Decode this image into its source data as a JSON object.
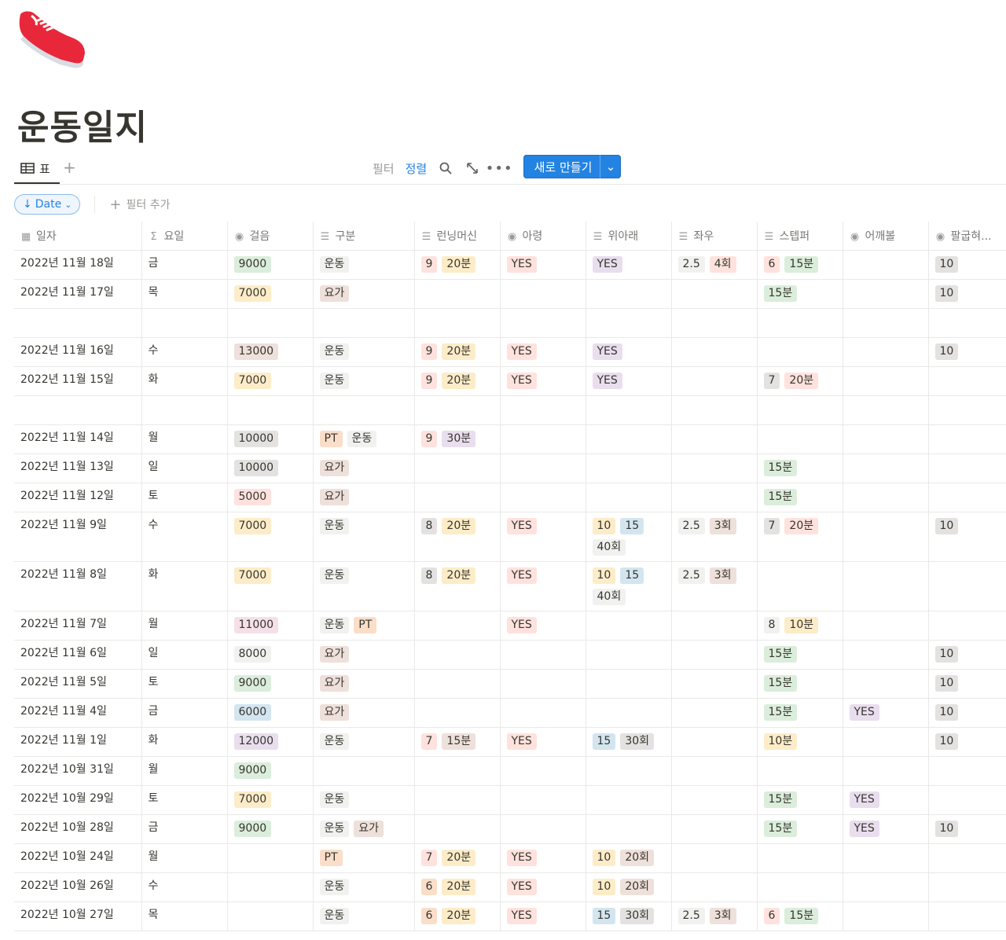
{
  "page": {
    "icon": "sneaker-icon",
    "title": "운동일지"
  },
  "views": {
    "tab_label": "표",
    "add_view_icon": "plus-icon"
  },
  "toolbar": {
    "filter": "필터",
    "sort": "정렬",
    "new_label": "새로 만들기"
  },
  "filterbar": {
    "date_chip": "Date",
    "add_filter": "필터 추가"
  },
  "colors": {
    "green": "#dbeddb",
    "yellow": "#fdecc8",
    "gray": "#e3e2e0",
    "lightgray": "#f1f1ef",
    "brown": "#eee0da",
    "orange": "#fadec9",
    "red": "#ffe2dd",
    "purple": "#e8deee",
    "blue": "#d3e5ef",
    "pink": "#f5e0e9",
    "accent": "#2383e2"
  },
  "columns": [
    {
      "key": "date",
      "label": "일자",
      "icon": "calendar-icon"
    },
    {
      "key": "day",
      "label": "요일",
      "icon": "sigma-icon"
    },
    {
      "key": "steps",
      "label": "걸음",
      "icon": "select-icon"
    },
    {
      "key": "type",
      "label": "구분",
      "icon": "list-icon"
    },
    {
      "key": "treadmill",
      "label": "런닝머신",
      "icon": "list-icon"
    },
    {
      "key": "arm",
      "label": "아령",
      "icon": "select-icon"
    },
    {
      "key": "updown",
      "label": "위아래",
      "icon": "list-icon"
    },
    {
      "key": "leftright",
      "label": "좌우",
      "icon": "list-icon"
    },
    {
      "key": "stepper",
      "label": "스텝퍼",
      "icon": "list-icon"
    },
    {
      "key": "shoulder",
      "label": "어깨볼",
      "icon": "select-icon"
    },
    {
      "key": "pushup",
      "label": "팔굽혀...",
      "icon": "select-icon"
    }
  ],
  "rows": [
    {
      "date": "2022년 11월 18일",
      "day": "금",
      "steps": [
        [
          "9000",
          "green"
        ]
      ],
      "type": [
        [
          "운동",
          "lightgray"
        ]
      ],
      "treadmill": [
        [
          "9",
          "red"
        ],
        [
          "20분",
          "yellow"
        ]
      ],
      "arm": [
        [
          "YES",
          "red"
        ]
      ],
      "updown": [
        [
          "YES",
          "purple"
        ]
      ],
      "leftright": [
        [
          "2.5",
          "lightgray"
        ],
        [
          "4회",
          "red"
        ]
      ],
      "stepper": [
        [
          "6",
          "red"
        ],
        [
          "15분",
          "green"
        ]
      ],
      "shoulder": [],
      "pushup": [
        [
          "10",
          "gray"
        ]
      ]
    },
    {
      "date": "2022년 11월 17일",
      "day": "목",
      "steps": [
        [
          "7000",
          "yellow"
        ]
      ],
      "type": [
        [
          "요가",
          "brown"
        ]
      ],
      "treadmill": [],
      "arm": [],
      "updown": [],
      "leftright": [],
      "stepper": [
        [
          "15분",
          "green"
        ]
      ],
      "shoulder": [],
      "pushup": [
        [
          "10",
          "gray"
        ]
      ]
    },
    {
      "date": "",
      "day": "",
      "steps": [],
      "type": [],
      "treadmill": [],
      "arm": [],
      "updown": [],
      "leftright": [],
      "stepper": [],
      "shoulder": [],
      "pushup": []
    },
    {
      "date": "2022년 11월 16일",
      "day": "수",
      "steps": [
        [
          "13000",
          "brown"
        ]
      ],
      "type": [
        [
          "운동",
          "lightgray"
        ]
      ],
      "treadmill": [
        [
          "9",
          "red"
        ],
        [
          "20분",
          "yellow"
        ]
      ],
      "arm": [
        [
          "YES",
          "red"
        ]
      ],
      "updown": [
        [
          "YES",
          "purple"
        ]
      ],
      "leftright": [],
      "stepper": [],
      "shoulder": [],
      "pushup": [
        [
          "10",
          "gray"
        ]
      ]
    },
    {
      "date": "2022년 11월 15일",
      "day": "화",
      "steps": [
        [
          "7000",
          "yellow"
        ]
      ],
      "type": [
        [
          "운동",
          "lightgray"
        ]
      ],
      "treadmill": [
        [
          "9",
          "red"
        ],
        [
          "20분",
          "yellow"
        ]
      ],
      "arm": [
        [
          "YES",
          "red"
        ]
      ],
      "updown": [
        [
          "YES",
          "purple"
        ]
      ],
      "leftright": [],
      "stepper": [
        [
          "7",
          "gray"
        ],
        [
          "20분",
          "red"
        ]
      ],
      "shoulder": [],
      "pushup": []
    },
    {
      "date": "",
      "day": "",
      "steps": [],
      "type": [],
      "treadmill": [],
      "arm": [],
      "updown": [],
      "leftright": [],
      "stepper": [],
      "shoulder": [],
      "pushup": []
    },
    {
      "date": "2022년 11월 14일",
      "day": "월",
      "steps": [
        [
          "10000",
          "gray"
        ]
      ],
      "type": [
        [
          "PT",
          "orange"
        ],
        [
          "운동",
          "lightgray"
        ]
      ],
      "treadmill": [
        [
          "9",
          "red"
        ],
        [
          "30분",
          "purple"
        ]
      ],
      "arm": [],
      "updown": [],
      "leftright": [],
      "stepper": [],
      "shoulder": [],
      "pushup": []
    },
    {
      "date": "2022년 11월 13일",
      "day": "일",
      "steps": [
        [
          "10000",
          "gray"
        ]
      ],
      "type": [
        [
          "요가",
          "brown"
        ]
      ],
      "treadmill": [],
      "arm": [],
      "updown": [],
      "leftright": [],
      "stepper": [
        [
          "15분",
          "green"
        ]
      ],
      "shoulder": [],
      "pushup": []
    },
    {
      "date": "2022년 11월 12일",
      "day": "토",
      "steps": [
        [
          "5000",
          "red"
        ]
      ],
      "type": [
        [
          "요가",
          "brown"
        ]
      ],
      "treadmill": [],
      "arm": [],
      "updown": [],
      "leftright": [],
      "stepper": [
        [
          "15분",
          "green"
        ]
      ],
      "shoulder": [],
      "pushup": []
    },
    {
      "date": "2022년 11월 9일",
      "day": "수",
      "steps": [
        [
          "7000",
          "yellow"
        ]
      ],
      "type": [
        [
          "운동",
          "lightgray"
        ]
      ],
      "treadmill": [
        [
          "8",
          "gray"
        ],
        [
          "20분",
          "yellow"
        ]
      ],
      "arm": [
        [
          "YES",
          "red"
        ]
      ],
      "updown": [
        [
          "10",
          "yellow"
        ],
        [
          "15",
          "blue"
        ],
        [
          "40회",
          "lightgray"
        ]
      ],
      "leftright": [
        [
          "2.5",
          "lightgray"
        ],
        [
          "3회",
          "brown"
        ]
      ],
      "stepper": [
        [
          "7",
          "gray"
        ],
        [
          "20분",
          "red"
        ]
      ],
      "shoulder": [],
      "pushup": [
        [
          "10",
          "gray"
        ]
      ]
    },
    {
      "date": "2022년 11월 8일",
      "day": "화",
      "steps": [
        [
          "7000",
          "yellow"
        ]
      ],
      "type": [
        [
          "운동",
          "lightgray"
        ]
      ],
      "treadmill": [
        [
          "8",
          "gray"
        ],
        [
          "20분",
          "yellow"
        ]
      ],
      "arm": [
        [
          "YES",
          "red"
        ]
      ],
      "updown": [
        [
          "10",
          "yellow"
        ],
        [
          "15",
          "blue"
        ],
        [
          "40회",
          "lightgray"
        ]
      ],
      "leftright": [
        [
          "2.5",
          "lightgray"
        ],
        [
          "3회",
          "brown"
        ]
      ],
      "stepper": [],
      "shoulder": [],
      "pushup": []
    },
    {
      "date": "2022년 11월 7일",
      "day": "월",
      "steps": [
        [
          "11000",
          "pink"
        ]
      ],
      "type": [
        [
          "운동",
          "lightgray"
        ],
        [
          "PT",
          "orange"
        ]
      ],
      "treadmill": [],
      "arm": [
        [
          "YES",
          "red"
        ]
      ],
      "updown": [],
      "leftright": [],
      "stepper": [
        [
          "8",
          "lightgray"
        ],
        [
          "10분",
          "yellow"
        ]
      ],
      "shoulder": [],
      "pushup": []
    },
    {
      "date": "2022년 11월 6일",
      "day": "일",
      "steps": [
        [
          "8000",
          "lightgray"
        ]
      ],
      "type": [
        [
          "요가",
          "brown"
        ]
      ],
      "treadmill": [],
      "arm": [],
      "updown": [],
      "leftright": [],
      "stepper": [
        [
          "15분",
          "green"
        ]
      ],
      "shoulder": [],
      "pushup": [
        [
          "10",
          "gray"
        ]
      ]
    },
    {
      "date": "2022년 11월 5일",
      "day": "토",
      "steps": [
        [
          "9000",
          "green"
        ]
      ],
      "type": [
        [
          "요가",
          "brown"
        ]
      ],
      "treadmill": [],
      "arm": [],
      "updown": [],
      "leftright": [],
      "stepper": [
        [
          "15분",
          "green"
        ]
      ],
      "shoulder": [],
      "pushup": [
        [
          "10",
          "gray"
        ]
      ]
    },
    {
      "date": "2022년 11월 4일",
      "day": "금",
      "steps": [
        [
          "6000",
          "blue"
        ]
      ],
      "type": [
        [
          "요가",
          "brown"
        ]
      ],
      "treadmill": [],
      "arm": [],
      "updown": [],
      "leftright": [],
      "stepper": [
        [
          "15분",
          "green"
        ]
      ],
      "shoulder": [
        [
          "YES",
          "purple"
        ]
      ],
      "pushup": [
        [
          "10",
          "gray"
        ]
      ]
    },
    {
      "date": "2022년 11월 1일",
      "day": "화",
      "steps": [
        [
          "12000",
          "purple"
        ]
      ],
      "type": [
        [
          "운동",
          "lightgray"
        ]
      ],
      "treadmill": [
        [
          "7",
          "red"
        ],
        [
          "15분",
          "brown"
        ]
      ],
      "arm": [
        [
          "YES",
          "red"
        ]
      ],
      "updown": [
        [
          "15",
          "blue"
        ],
        [
          "30회",
          "gray"
        ]
      ],
      "leftright": [],
      "stepper": [
        [
          "10분",
          "yellow"
        ]
      ],
      "shoulder": [],
      "pushup": [
        [
          "10",
          "gray"
        ]
      ]
    },
    {
      "date": "2022년 10월 31일",
      "day": "월",
      "steps": [
        [
          "9000",
          "green"
        ]
      ],
      "type": [],
      "treadmill": [],
      "arm": [],
      "updown": [],
      "leftright": [],
      "stepper": [],
      "shoulder": [],
      "pushup": []
    },
    {
      "date": "2022년 10월 29일",
      "day": "토",
      "steps": [
        [
          "7000",
          "yellow"
        ]
      ],
      "type": [
        [
          "운동",
          "lightgray"
        ]
      ],
      "treadmill": [],
      "arm": [],
      "updown": [],
      "leftright": [],
      "stepper": [
        [
          "15분",
          "green"
        ]
      ],
      "shoulder": [
        [
          "YES",
          "purple"
        ]
      ],
      "pushup": []
    },
    {
      "date": "2022년 10월 28일",
      "day": "금",
      "steps": [
        [
          "9000",
          "green"
        ]
      ],
      "type": [
        [
          "운동",
          "lightgray"
        ],
        [
          "요가",
          "brown"
        ]
      ],
      "treadmill": [],
      "arm": [],
      "updown": [],
      "leftright": [],
      "stepper": [
        [
          "15분",
          "green"
        ]
      ],
      "shoulder": [
        [
          "YES",
          "purple"
        ]
      ],
      "pushup": [
        [
          "10",
          "gray"
        ]
      ]
    },
    {
      "date": "2022년 10월 24일",
      "day": "월",
      "steps": [],
      "type": [
        [
          "PT",
          "orange"
        ]
      ],
      "treadmill": [
        [
          "7",
          "red"
        ],
        [
          "20분",
          "yellow"
        ]
      ],
      "arm": [
        [
          "YES",
          "red"
        ]
      ],
      "updown": [
        [
          "10",
          "yellow"
        ],
        [
          "20회",
          "brown"
        ]
      ],
      "leftright": [],
      "stepper": [],
      "shoulder": [],
      "pushup": []
    },
    {
      "date": "2022년 10월 26일",
      "day": "수",
      "steps": [],
      "type": [
        [
          "운동",
          "lightgray"
        ]
      ],
      "treadmill": [
        [
          "6",
          "orange"
        ],
        [
          "20분",
          "yellow"
        ]
      ],
      "arm": [
        [
          "YES",
          "red"
        ]
      ],
      "updown": [
        [
          "10",
          "yellow"
        ],
        [
          "20회",
          "brown"
        ]
      ],
      "leftright": [],
      "stepper": [],
      "shoulder": [],
      "pushup": []
    },
    {
      "date": "2022년 10월 27일",
      "day": "목",
      "steps": [],
      "type": [
        [
          "운동",
          "lightgray"
        ]
      ],
      "treadmill": [
        [
          "6",
          "orange"
        ],
        [
          "20분",
          "yellow"
        ]
      ],
      "arm": [
        [
          "YES",
          "red"
        ]
      ],
      "updown": [
        [
          "15",
          "blue"
        ],
        [
          "30회",
          "gray"
        ]
      ],
      "leftright": [
        [
          "2.5",
          "lightgray"
        ],
        [
          "3회",
          "brown"
        ]
      ],
      "stepper": [
        [
          "6",
          "red"
        ],
        [
          "15분",
          "green"
        ]
      ],
      "shoulder": [],
      "pushup": []
    }
  ]
}
